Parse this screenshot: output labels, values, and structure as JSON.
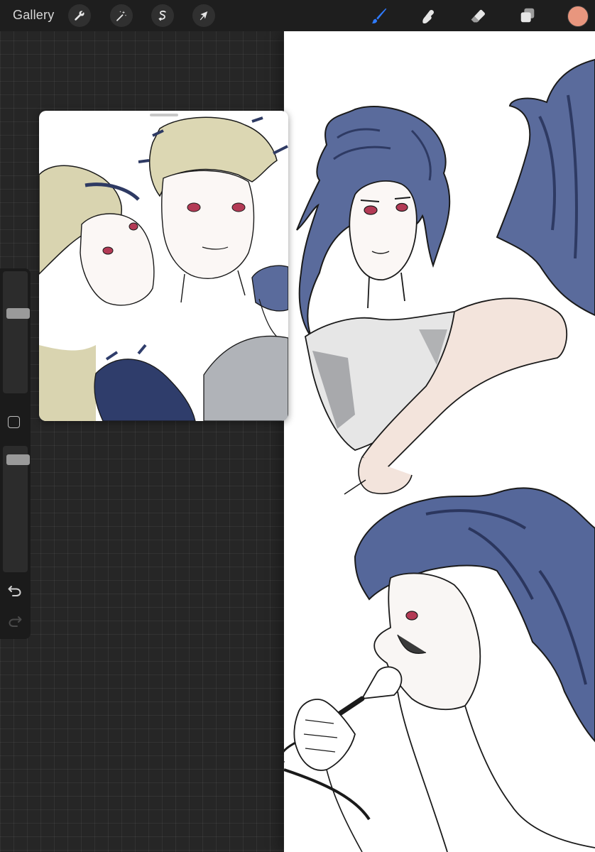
{
  "topbar": {
    "gallery_label": "Gallery",
    "left_tools": [
      {
        "name": "actions",
        "icon": "wrench-icon"
      },
      {
        "name": "adjustments",
        "icon": "magic-wand-icon"
      },
      {
        "name": "selection",
        "icon": "selection-s-icon"
      },
      {
        "name": "transform",
        "icon": "cursor-arrow-icon"
      }
    ],
    "right_tools": [
      {
        "name": "brush",
        "icon": "brush-icon",
        "active": true
      },
      {
        "name": "smudge",
        "icon": "smudge-finger-icon",
        "active": false
      },
      {
        "name": "eraser",
        "icon": "eraser-icon",
        "active": false
      },
      {
        "name": "layers",
        "icon": "layers-icon",
        "active": false
      }
    ],
    "current_color": "#e8967e",
    "accent_color": "#2f7bff"
  },
  "sidebar": {
    "brush_size_level": 0.68,
    "opacity_level": 0.95,
    "modify_icon": "square-modify-icon",
    "undo_icon": "undo-icon",
    "redo_icon": "redo-icon",
    "redo_enabled": false
  },
  "reference_window": {
    "visible": true,
    "content": "illustration"
  }
}
